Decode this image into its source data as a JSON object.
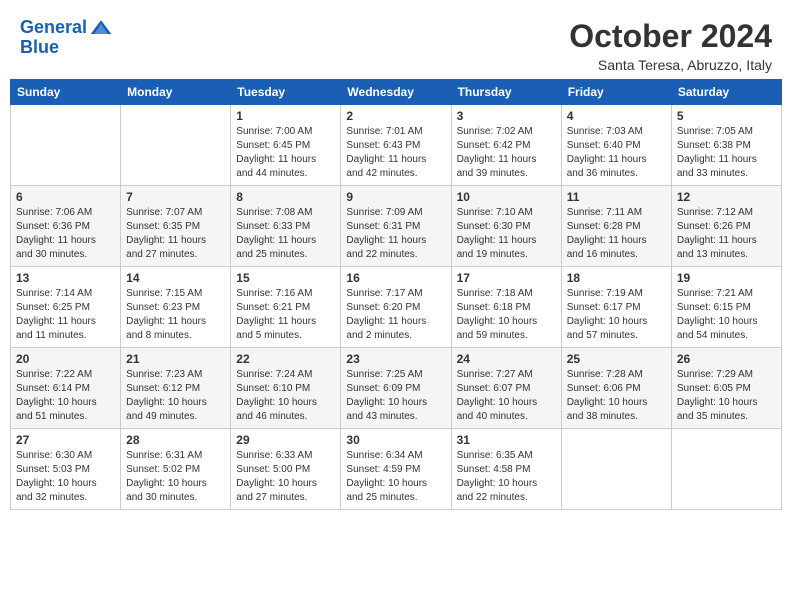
{
  "header": {
    "logo_line1": "General",
    "logo_line2": "Blue",
    "month_title": "October 2024",
    "location": "Santa Teresa, Abruzzo, Italy"
  },
  "weekdays": [
    "Sunday",
    "Monday",
    "Tuesday",
    "Wednesday",
    "Thursday",
    "Friday",
    "Saturday"
  ],
  "weeks": [
    [
      {
        "day": "",
        "sunrise": "",
        "sunset": "",
        "daylight": ""
      },
      {
        "day": "",
        "sunrise": "",
        "sunset": "",
        "daylight": ""
      },
      {
        "day": "1",
        "sunrise": "Sunrise: 7:00 AM",
        "sunset": "Sunset: 6:45 PM",
        "daylight": "Daylight: 11 hours and 44 minutes."
      },
      {
        "day": "2",
        "sunrise": "Sunrise: 7:01 AM",
        "sunset": "Sunset: 6:43 PM",
        "daylight": "Daylight: 11 hours and 42 minutes."
      },
      {
        "day": "3",
        "sunrise": "Sunrise: 7:02 AM",
        "sunset": "Sunset: 6:42 PM",
        "daylight": "Daylight: 11 hours and 39 minutes."
      },
      {
        "day": "4",
        "sunrise": "Sunrise: 7:03 AM",
        "sunset": "Sunset: 6:40 PM",
        "daylight": "Daylight: 11 hours and 36 minutes."
      },
      {
        "day": "5",
        "sunrise": "Sunrise: 7:05 AM",
        "sunset": "Sunset: 6:38 PM",
        "daylight": "Daylight: 11 hours and 33 minutes."
      }
    ],
    [
      {
        "day": "6",
        "sunrise": "Sunrise: 7:06 AM",
        "sunset": "Sunset: 6:36 PM",
        "daylight": "Daylight: 11 hours and 30 minutes."
      },
      {
        "day": "7",
        "sunrise": "Sunrise: 7:07 AM",
        "sunset": "Sunset: 6:35 PM",
        "daylight": "Daylight: 11 hours and 27 minutes."
      },
      {
        "day": "8",
        "sunrise": "Sunrise: 7:08 AM",
        "sunset": "Sunset: 6:33 PM",
        "daylight": "Daylight: 11 hours and 25 minutes."
      },
      {
        "day": "9",
        "sunrise": "Sunrise: 7:09 AM",
        "sunset": "Sunset: 6:31 PM",
        "daylight": "Daylight: 11 hours and 22 minutes."
      },
      {
        "day": "10",
        "sunrise": "Sunrise: 7:10 AM",
        "sunset": "Sunset: 6:30 PM",
        "daylight": "Daylight: 11 hours and 19 minutes."
      },
      {
        "day": "11",
        "sunrise": "Sunrise: 7:11 AM",
        "sunset": "Sunset: 6:28 PM",
        "daylight": "Daylight: 11 hours and 16 minutes."
      },
      {
        "day": "12",
        "sunrise": "Sunrise: 7:12 AM",
        "sunset": "Sunset: 6:26 PM",
        "daylight": "Daylight: 11 hours and 13 minutes."
      }
    ],
    [
      {
        "day": "13",
        "sunrise": "Sunrise: 7:14 AM",
        "sunset": "Sunset: 6:25 PM",
        "daylight": "Daylight: 11 hours and 11 minutes."
      },
      {
        "day": "14",
        "sunrise": "Sunrise: 7:15 AM",
        "sunset": "Sunset: 6:23 PM",
        "daylight": "Daylight: 11 hours and 8 minutes."
      },
      {
        "day": "15",
        "sunrise": "Sunrise: 7:16 AM",
        "sunset": "Sunset: 6:21 PM",
        "daylight": "Daylight: 11 hours and 5 minutes."
      },
      {
        "day": "16",
        "sunrise": "Sunrise: 7:17 AM",
        "sunset": "Sunset: 6:20 PM",
        "daylight": "Daylight: 11 hours and 2 minutes."
      },
      {
        "day": "17",
        "sunrise": "Sunrise: 7:18 AM",
        "sunset": "Sunset: 6:18 PM",
        "daylight": "Daylight: 10 hours and 59 minutes."
      },
      {
        "day": "18",
        "sunrise": "Sunrise: 7:19 AM",
        "sunset": "Sunset: 6:17 PM",
        "daylight": "Daylight: 10 hours and 57 minutes."
      },
      {
        "day": "19",
        "sunrise": "Sunrise: 7:21 AM",
        "sunset": "Sunset: 6:15 PM",
        "daylight": "Daylight: 10 hours and 54 minutes."
      }
    ],
    [
      {
        "day": "20",
        "sunrise": "Sunrise: 7:22 AM",
        "sunset": "Sunset: 6:14 PM",
        "daylight": "Daylight: 10 hours and 51 minutes."
      },
      {
        "day": "21",
        "sunrise": "Sunrise: 7:23 AM",
        "sunset": "Sunset: 6:12 PM",
        "daylight": "Daylight: 10 hours and 49 minutes."
      },
      {
        "day": "22",
        "sunrise": "Sunrise: 7:24 AM",
        "sunset": "Sunset: 6:10 PM",
        "daylight": "Daylight: 10 hours and 46 minutes."
      },
      {
        "day": "23",
        "sunrise": "Sunrise: 7:25 AM",
        "sunset": "Sunset: 6:09 PM",
        "daylight": "Daylight: 10 hours and 43 minutes."
      },
      {
        "day": "24",
        "sunrise": "Sunrise: 7:27 AM",
        "sunset": "Sunset: 6:07 PM",
        "daylight": "Daylight: 10 hours and 40 minutes."
      },
      {
        "day": "25",
        "sunrise": "Sunrise: 7:28 AM",
        "sunset": "Sunset: 6:06 PM",
        "daylight": "Daylight: 10 hours and 38 minutes."
      },
      {
        "day": "26",
        "sunrise": "Sunrise: 7:29 AM",
        "sunset": "Sunset: 6:05 PM",
        "daylight": "Daylight: 10 hours and 35 minutes."
      }
    ],
    [
      {
        "day": "27",
        "sunrise": "Sunrise: 6:30 AM",
        "sunset": "Sunset: 5:03 PM",
        "daylight": "Daylight: 10 hours and 32 minutes."
      },
      {
        "day": "28",
        "sunrise": "Sunrise: 6:31 AM",
        "sunset": "Sunset: 5:02 PM",
        "daylight": "Daylight: 10 hours and 30 minutes."
      },
      {
        "day": "29",
        "sunrise": "Sunrise: 6:33 AM",
        "sunset": "Sunset: 5:00 PM",
        "daylight": "Daylight: 10 hours and 27 minutes."
      },
      {
        "day": "30",
        "sunrise": "Sunrise: 6:34 AM",
        "sunset": "Sunset: 4:59 PM",
        "daylight": "Daylight: 10 hours and 25 minutes."
      },
      {
        "day": "31",
        "sunrise": "Sunrise: 6:35 AM",
        "sunset": "Sunset: 4:58 PM",
        "daylight": "Daylight: 10 hours and 22 minutes."
      },
      {
        "day": "",
        "sunrise": "",
        "sunset": "",
        "daylight": ""
      },
      {
        "day": "",
        "sunrise": "",
        "sunset": "",
        "daylight": ""
      }
    ]
  ]
}
